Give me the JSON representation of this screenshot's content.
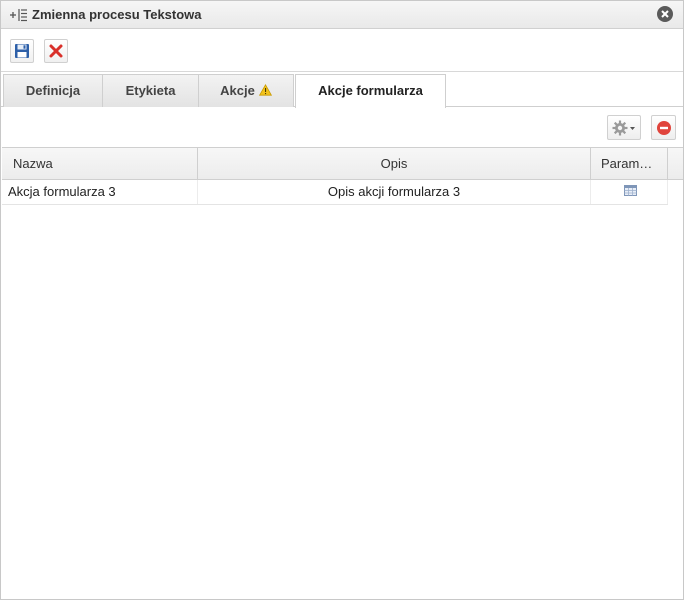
{
  "window": {
    "title": "Zmienna procesu Tekstowa"
  },
  "tabs": [
    {
      "label": "Definicja"
    },
    {
      "label": "Etykieta"
    },
    {
      "label": "Akcje"
    },
    {
      "label": "Akcje formularza"
    }
  ],
  "grid": {
    "columns": [
      {
        "label": "Nazwa"
      },
      {
        "label": "Opis"
      },
      {
        "label": "Param…"
      }
    ],
    "rows": [
      {
        "nazwa": "Akcja formularza 3",
        "opis": "Opis akcji formularza 3",
        "param_icon": "table-icon"
      }
    ]
  },
  "icons": {
    "title": "variable-tree-icon",
    "close": "close-icon",
    "save": "save-icon",
    "cancel": "delete-x-icon",
    "warning": "warning-icon",
    "settings": "gear-icon",
    "remove": "remove-icon"
  },
  "colors": {
    "cancel_red": "#d9302a",
    "warning_yellow": "#f2c21b",
    "remove_red": "#e0443c",
    "save_blue": "#2d5fa8"
  }
}
